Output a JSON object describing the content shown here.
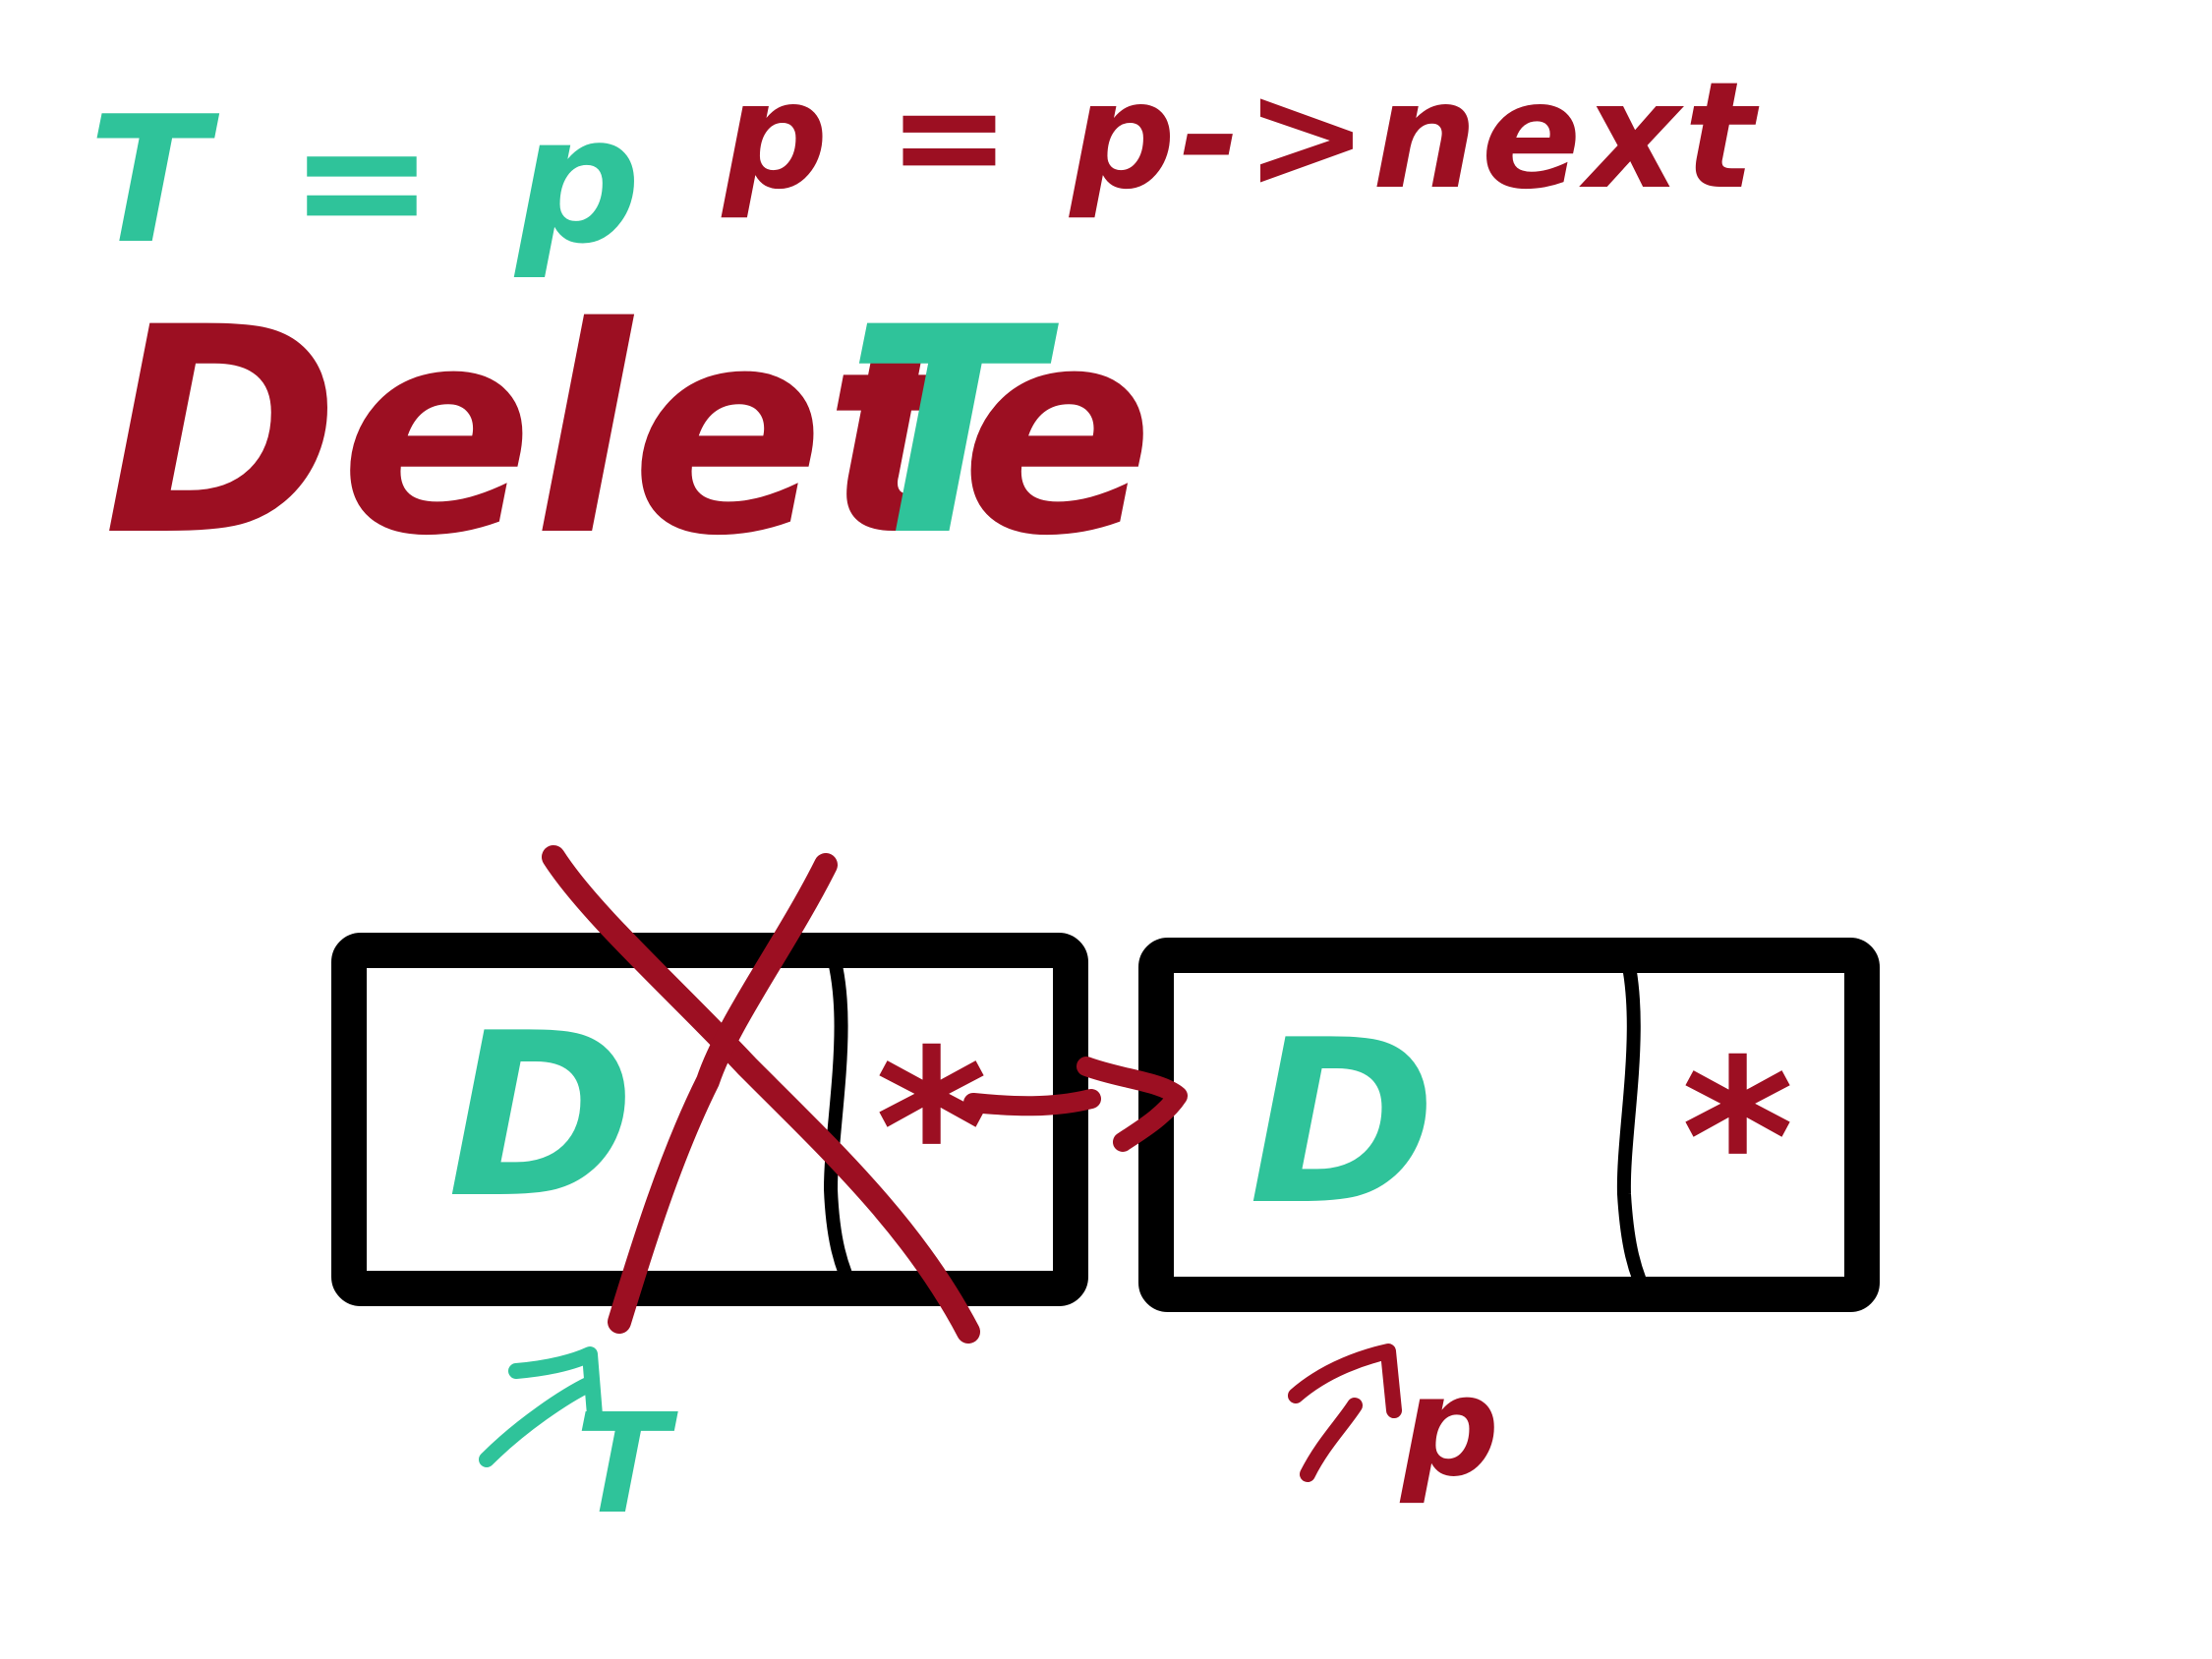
{
  "colors": {
    "teal": "#2fc39a",
    "crimson": "#9c0f22",
    "ink": "#000000",
    "background": "#ffffff"
  },
  "header": {
    "assign_t": "T = p",
    "assign_p": "p = p->next"
  },
  "title": {
    "verb": "Delete",
    "target": "T"
  },
  "nodes": [
    {
      "data": "D",
      "next": "*",
      "deleted": true
    },
    {
      "data": "D",
      "next": "*",
      "deleted": false
    }
  ],
  "pointers": {
    "under_first": "T",
    "under_second": "p"
  }
}
